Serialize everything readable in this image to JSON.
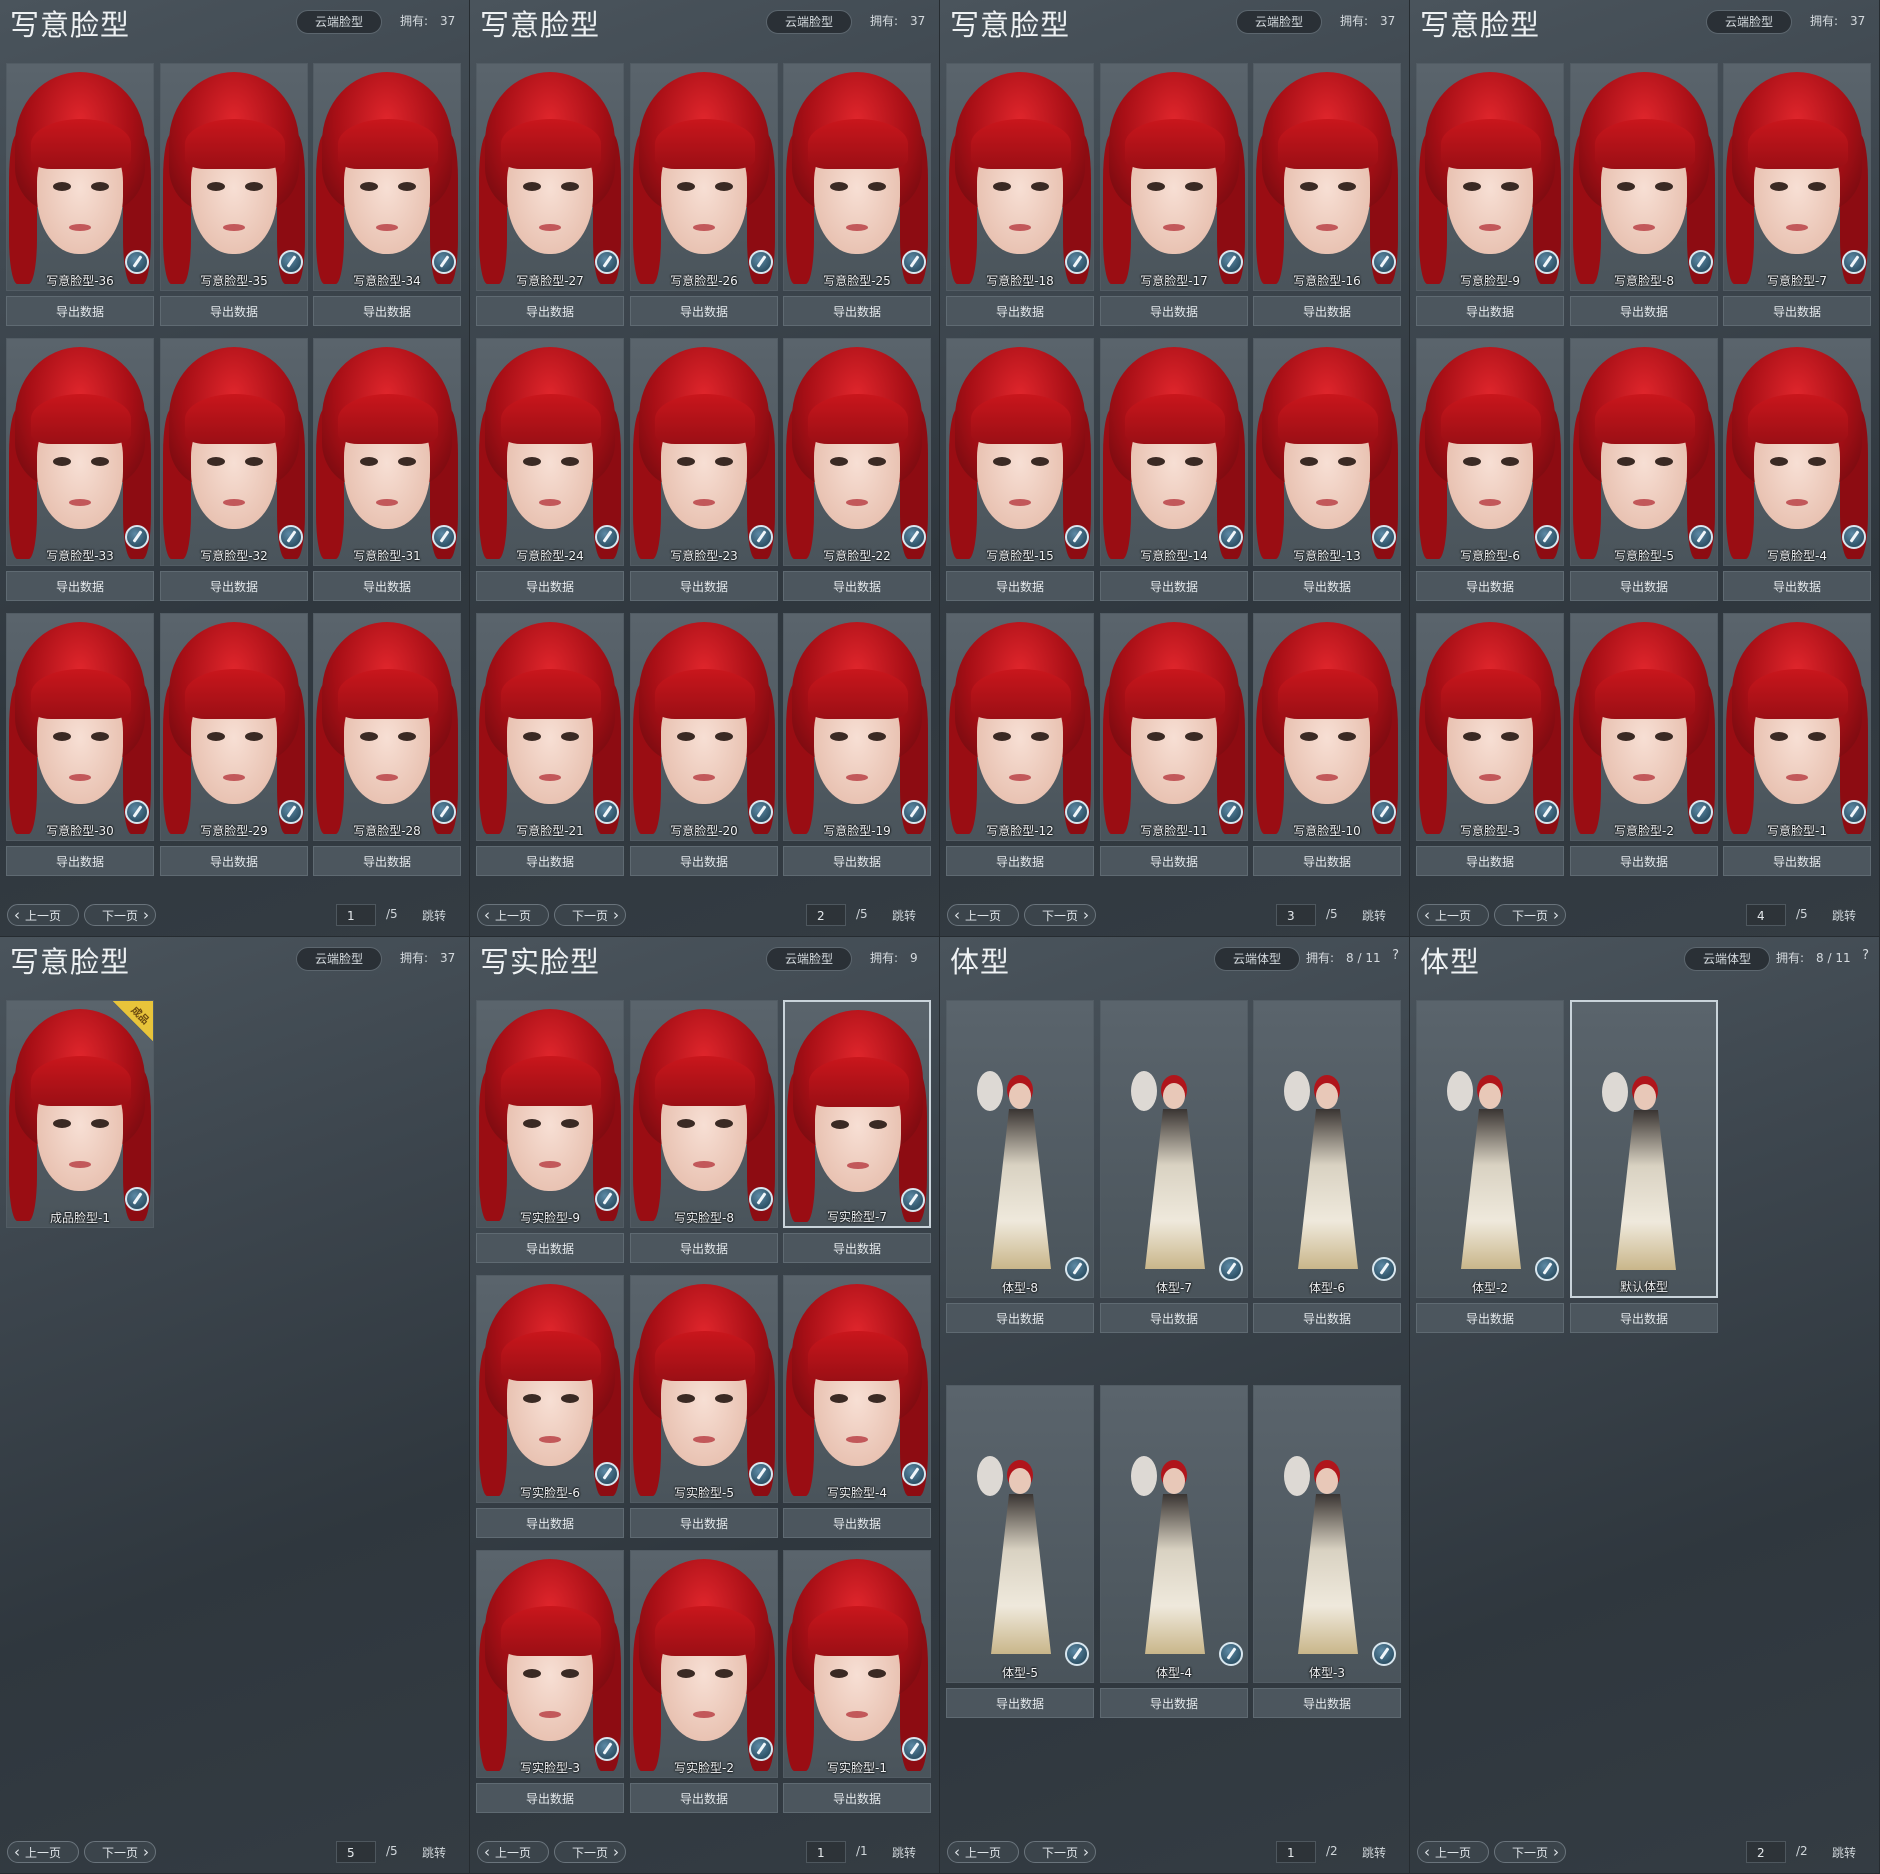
{
  "common": {
    "owned_label": "拥有:",
    "export_label": "导出数据",
    "prev_label": "上一页",
    "next_label": "下一页",
    "jump_label": "跳转"
  },
  "panels": [
    {
      "title": "写意脸型",
      "cloud_btn": "云端脸型",
      "owned": "37",
      "page": "1",
      "total": "/5",
      "cards": [
        "写意脸型-36",
        "写意脸型-35",
        "写意脸型-34",
        "写意脸型-33",
        "写意脸型-32",
        "写意脸型-31",
        "写意脸型-30",
        "写意脸型-29",
        "写意脸型-28"
      ]
    },
    {
      "title": "写意脸型",
      "cloud_btn": "云端脸型",
      "owned": "37",
      "page": "2",
      "total": "/5",
      "cards": [
        "写意脸型-27",
        "写意脸型-26",
        "写意脸型-25",
        "写意脸型-24",
        "写意脸型-23",
        "写意脸型-22",
        "写意脸型-21",
        "写意脸型-20",
        "写意脸型-19"
      ]
    },
    {
      "title": "写意脸型",
      "cloud_btn": "云端脸型",
      "owned": "37",
      "page": "3",
      "total": "/5",
      "cards": [
        "写意脸型-18",
        "写意脸型-17",
        "写意脸型-16",
        "写意脸型-15",
        "写意脸型-14",
        "写意脸型-13",
        "写意脸型-12",
        "写意脸型-11",
        "写意脸型-10"
      ]
    },
    {
      "title": "写意脸型",
      "cloud_btn": "云端脸型",
      "owned": "37",
      "page": "4",
      "total": "/5",
      "cards": [
        "写意脸型-9",
        "写意脸型-8",
        "写意脸型-7",
        "写意脸型-6",
        "写意脸型-5",
        "写意脸型-4",
        "写意脸型-3",
        "写意脸型-2",
        "写意脸型-1"
      ]
    },
    {
      "title": "写意脸型",
      "cloud_btn": "云端脸型",
      "owned": "37",
      "page": "5",
      "total": "/5",
      "cards": [
        "成品脸型-1"
      ],
      "badge": "成品"
    },
    {
      "title": "写实脸型",
      "cloud_btn": "云端脸型",
      "owned": "9",
      "page": "1",
      "total": "/1",
      "cards": [
        "写实脸型-9",
        "写实脸型-8",
        "写实脸型-7",
        "写实脸型-6",
        "写实脸型-5",
        "写实脸型-4",
        "写实脸型-3",
        "写实脸型-2",
        "写实脸型-1"
      ]
    },
    {
      "title": "体型",
      "cloud_btn": "云端体型",
      "owned": "8 / 11",
      "help": "?",
      "page": "1",
      "total": "/2",
      "cards": [
        "体型-8",
        "体型-7",
        "体型-6",
        "体型-5",
        "体型-4",
        "体型-3"
      ]
    },
    {
      "title": "体型",
      "cloud_btn": "云端体型",
      "owned": "8 / 11",
      "help": "?",
      "page": "2",
      "total": "/2",
      "cards": [
        "体型-2",
        "默认体型"
      ]
    }
  ]
}
